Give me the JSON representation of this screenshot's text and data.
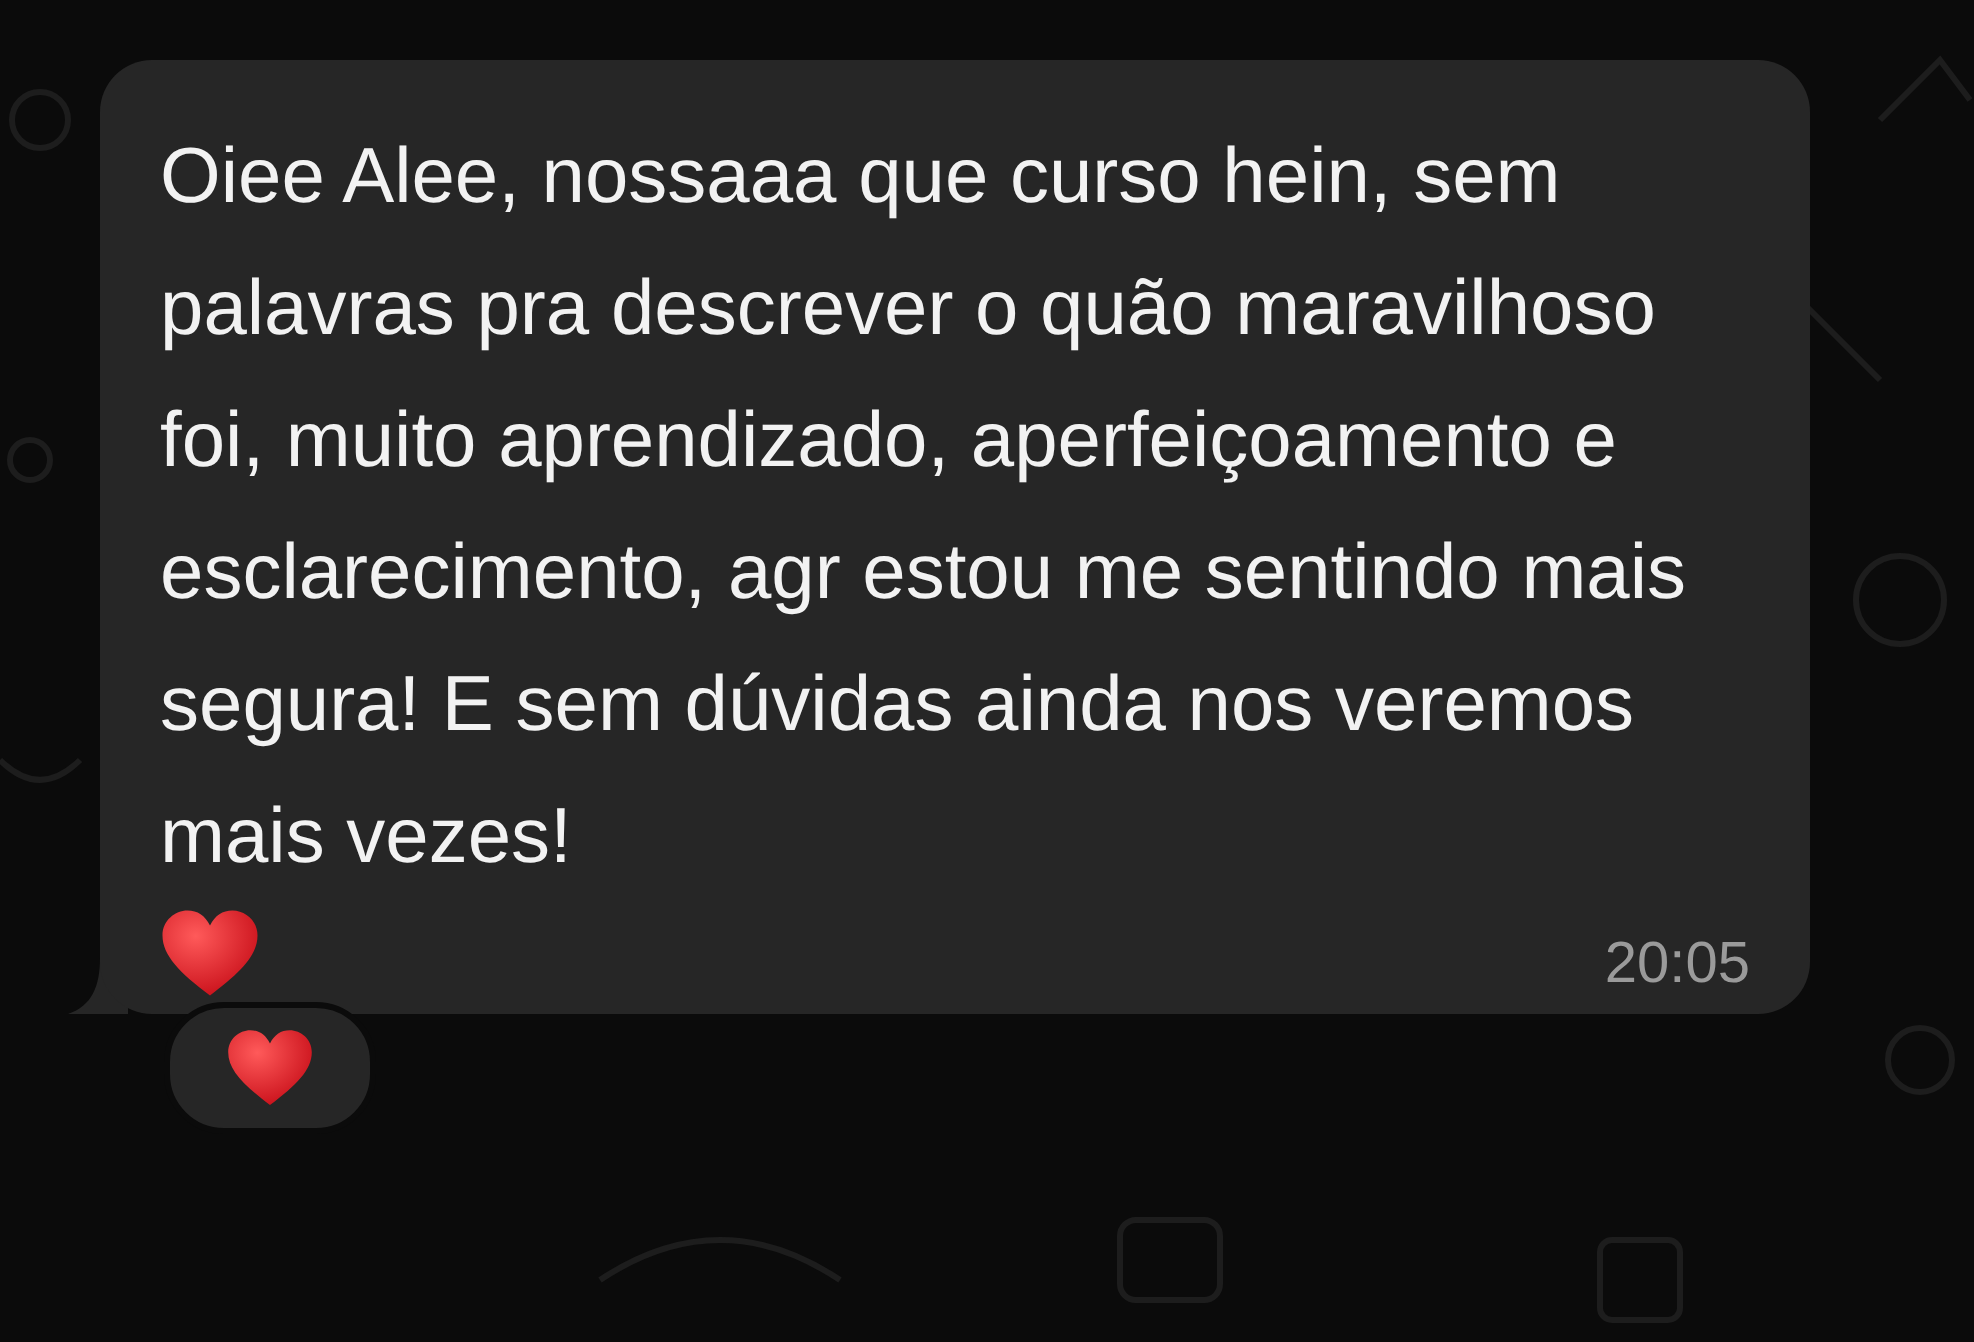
{
  "message": {
    "text": "Oiee Alee, nossaaa que curso hein, sem palavras pra descrever o quão maravilhoso foi, muito aprendizado, aperfeiçoamento e esclarecimento, agr estou me sentindo mais segura! E sem dúvidas ainda nos veremos mais vezes!",
    "trailing_emoji": {
      "kind": "heart"
    },
    "time": "20:05"
  },
  "reactions": [
    {
      "kind": "heart"
    }
  ]
}
